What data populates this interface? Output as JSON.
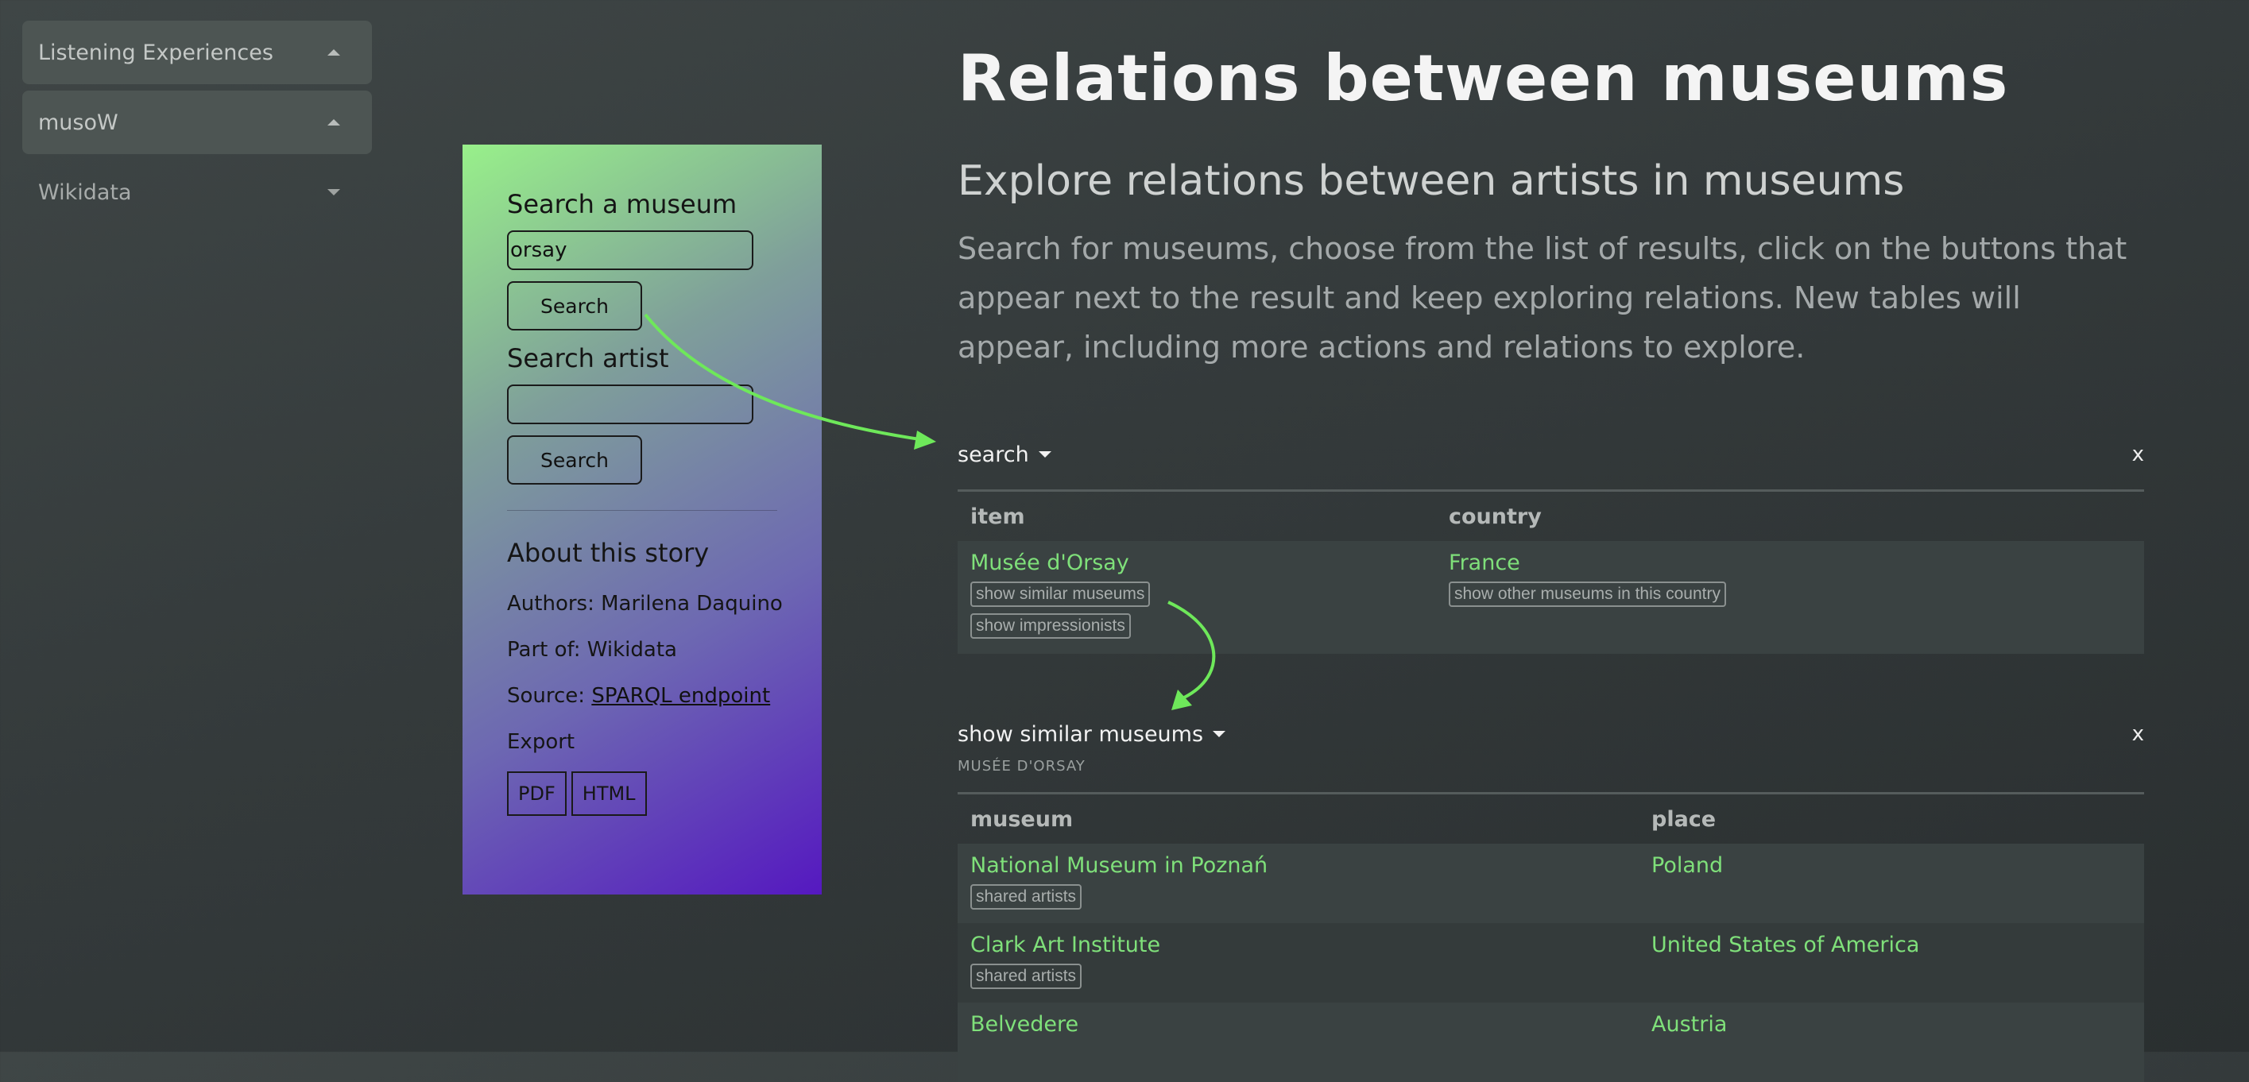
{
  "sidebar": {
    "items": [
      {
        "label": "Listening Experiences"
      },
      {
        "label": "musoW"
      },
      {
        "label": "Wikidata"
      }
    ]
  },
  "story": {
    "search_museum_label": "Search a museum",
    "search_museum_value": "orsay",
    "search_button": "Search",
    "search_artist_label": "Search artist",
    "search_artist_value": "",
    "search_artist_button": "Search",
    "about_title": "About this story",
    "authors": "Authors: Marilena Daquino",
    "part_of": "Part of: Wikidata",
    "source_prefix": "Source: ",
    "source_link": "SPARQL endpoint",
    "export_label": "Export",
    "export_buttons": [
      "PDF",
      "HTML"
    ]
  },
  "main": {
    "title": "Relations between museums",
    "subtitle": "Explore relations between artists in museums",
    "lead": "Search for museums, choose from the list of results, click on the buttons that appear next to the result and keep exploring relations. New tables will appear, including more actions and relations to explore."
  },
  "panel1": {
    "title": "search",
    "close": "x",
    "columns": [
      "item",
      "country"
    ],
    "rows": [
      {
        "item": "Musée d'Orsay",
        "item_actions": [
          "show similar museums",
          "show impressionists"
        ],
        "country": "France",
        "country_actions": [
          "show other museums in this country"
        ]
      }
    ]
  },
  "panel2": {
    "title": "show similar museums",
    "subtitle": "MUSÉE D'ORSAY",
    "close": "x",
    "columns": [
      "museum",
      "place"
    ],
    "rows": [
      {
        "museum": "National Museum in Poznań",
        "action": "shared artists",
        "place": "Poland"
      },
      {
        "museum": "Clark Art Institute",
        "action": "shared artists",
        "place": "United States of America"
      },
      {
        "museum": "Belvedere",
        "action": "",
        "place": "Austria"
      }
    ]
  },
  "colors": {
    "accent": "#7fe07a",
    "arrow": "#6ee85a",
    "card_top": "#98f08a",
    "card_bottom": "#5518c0"
  }
}
